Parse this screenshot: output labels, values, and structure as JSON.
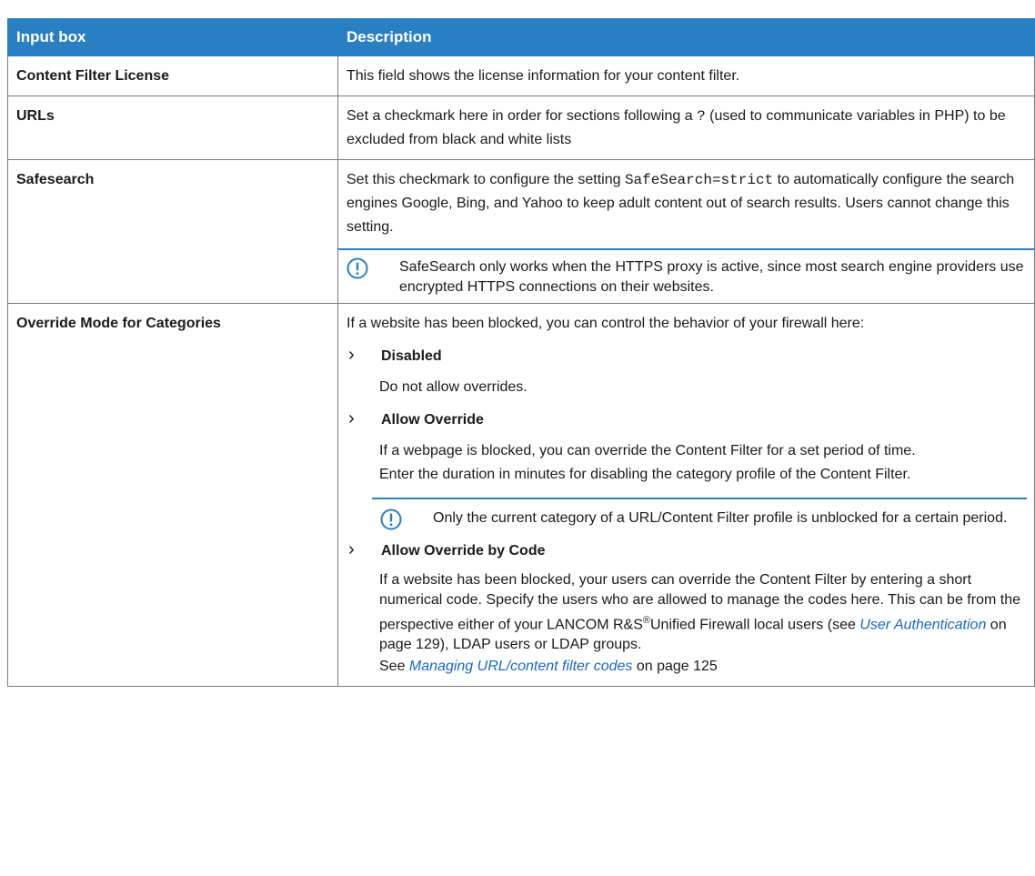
{
  "table": {
    "headers": [
      "Input box",
      "Description"
    ],
    "rows": {
      "license": {
        "key": "Content Filter License",
        "desc": "This field shows the license information for your content filter."
      },
      "urls": {
        "key": "URLs",
        "desc_a": "Set a checkmark here in order for sections following a ",
        "desc_code": "?",
        "desc_b": " (used to communicate variables in PHP) to be excluded from black and white lists"
      },
      "safesearch": {
        "key": "Safesearch",
        "desc_a": "Set this checkmark to configure the setting ",
        "desc_code": "SafeSearch=strict",
        "desc_b": " to automatically configure the search engines Google, Bing, and Yahoo to keep adult content out of search results. Users cannot change this setting.",
        "note": "SafeSearch only works when the HTTPS proxy is active, since most search engine providers use encrypted HTTPS connections on their websites."
      },
      "override": {
        "key": "Override Mode for Categories",
        "intro": "If a website has been blocked, you can control the behavior of your firewall here:",
        "disabled_title": "Disabled",
        "disabled_text": "Do not allow overrides.",
        "allow_title": "Allow Override",
        "allow_text1": "If a webpage is blocked, you can override the Content Filter for a set period of time.",
        "allow_text2": "Enter the duration in minutes for disabling the category profile of the Content Filter.",
        "allow_note": "Only the current category of a URL/Content Filter profile is unblocked for a certain period.",
        "code_title": "Allow Override by Code",
        "code_text_a": "If a website has been blocked, your users can override the Content Filter by entering a short numerical code. Specify the users who are allowed to manage the codes here. This can be from the perspective either of your LANCOM R&S",
        "code_text_reg": "®",
        "code_text_b": "Unified Firewall local users (see ",
        "code_link1": "User Authentication",
        "code_text_c": " on page 129), LDAP users or LDAP groups.",
        "see_a": "See ",
        "see_link": "Managing URL/content filter codes",
        "see_b": " on page 125"
      }
    }
  },
  "colors": {
    "header_bg": "#2a7fc3",
    "link": "#1a66c2"
  },
  "icons": {
    "note": "exclamation-circle-icon",
    "bullet": "chevron-right-icon"
  }
}
